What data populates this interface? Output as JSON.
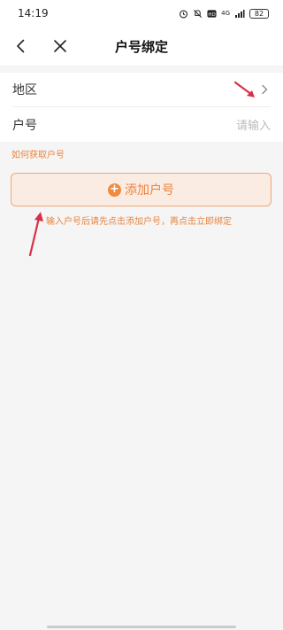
{
  "status_bar": {
    "time": "14:19",
    "icons": [
      "alarm-icon",
      "mute-icon",
      "hd-icon",
      "signal-icon"
    ],
    "network_label": "4G",
    "battery": "82"
  },
  "nav": {
    "title": "户号绑定"
  },
  "form": {
    "region_label": "地区",
    "account_label": "户号",
    "account_placeholder": "请输入"
  },
  "help_link": "如何获取户号",
  "add_button_label": "添加户号",
  "hint": "输入户号后请先点击添加户号，再点击立即绑定",
  "colors": {
    "accent": "#e8843f",
    "annotation_arrow": "#d9304a"
  }
}
